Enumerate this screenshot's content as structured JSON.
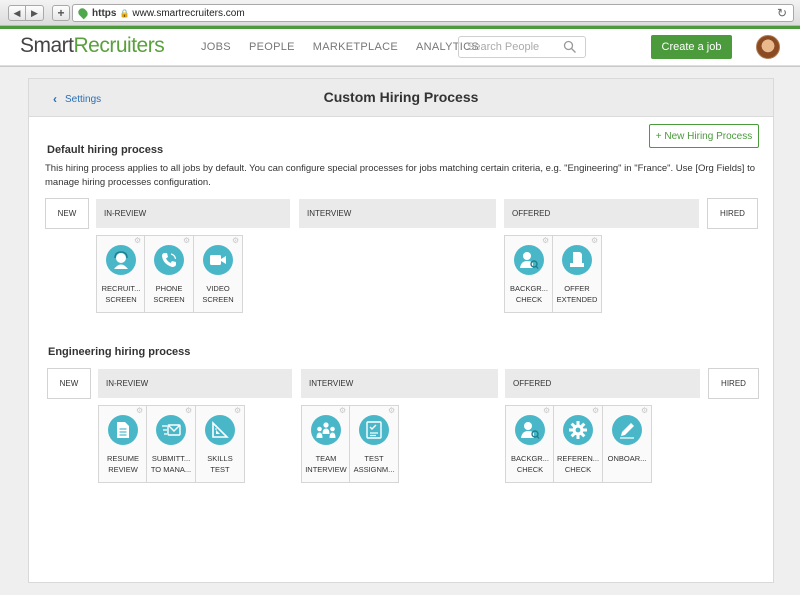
{
  "browser": {
    "https": "https",
    "url": "www.smartrecruiters.com",
    "back": "◀",
    "forward": "▶",
    "plus": "+",
    "reload": "↻",
    "lock": "🔒"
  },
  "header": {
    "logo_smart": "Smart",
    "logo_recruiters": "Recruiters",
    "nav": [
      "JOBS",
      "PEOPLE",
      "MARKETPLACE",
      "ANALYTICS"
    ],
    "search_placeholder": "Search People",
    "create_job": "Create a job"
  },
  "page": {
    "back_label": "Settings",
    "title": "Custom Hiring Process",
    "new_process_button": "+ New Hiring Process"
  },
  "default_process": {
    "title": "Default hiring process",
    "description": "This hiring process applies to all jobs by default. You can configure special processes for jobs matching certain criteria, e.g. \"Engineering\" in \"France\".  Use [Org Fields] to manage hiring processes configuration.",
    "stages": {
      "new": "NEW",
      "in_review": "IN-REVIEW",
      "interview": "INTERVIEW",
      "offered": "OFFERED",
      "hired": "HIRED"
    },
    "in_review_steps": [
      {
        "line1": "RECRUIT...",
        "line2": "SCREEN",
        "icon": "recruiter-icon"
      },
      {
        "line1": "PHONE",
        "line2": "SCREEN",
        "icon": "phone-icon"
      },
      {
        "line1": "VIDEO",
        "line2": "SCREEN",
        "icon": "video-camera-icon"
      }
    ],
    "offered_steps": [
      {
        "line1": "BACKGR...",
        "line2": "CHECK",
        "icon": "background-check-icon"
      },
      {
        "line1": "OFFER",
        "line2": "EXTENDED",
        "icon": "offer-document-icon"
      }
    ]
  },
  "engineering_process": {
    "title": "Engineering hiring process",
    "stages": {
      "new": "NEW",
      "in_review": "IN-REVIEW",
      "interview": "INTERVIEW",
      "offered": "OFFERED",
      "hired": "HIRED"
    },
    "in_review_steps": [
      {
        "line1": "RESUME",
        "line2": "REVIEW",
        "icon": "resume-icon"
      },
      {
        "line1": "SUBMITT...",
        "line2": "TO MANA...",
        "icon": "submit-to-manager-icon"
      },
      {
        "line1": "SKILLS",
        "line2": "TEST",
        "icon": "skills-test-icon"
      }
    ],
    "interview_steps": [
      {
        "line1": "TEAM",
        "line2": "INTERVIEW",
        "icon": "team-icon"
      },
      {
        "line1": "TEST",
        "line2": "ASSIGNM...",
        "icon": "test-assignment-icon"
      }
    ],
    "offered_steps": [
      {
        "line1": "BACKGR...",
        "line2": "CHECK",
        "icon": "background-check-icon"
      },
      {
        "line1": "REFEREN...",
        "line2": "CHECK",
        "icon": "reference-check-icon"
      },
      {
        "line1": "ONBOAR...",
        "line2": "",
        "icon": "onboarding-icon"
      }
    ]
  }
}
